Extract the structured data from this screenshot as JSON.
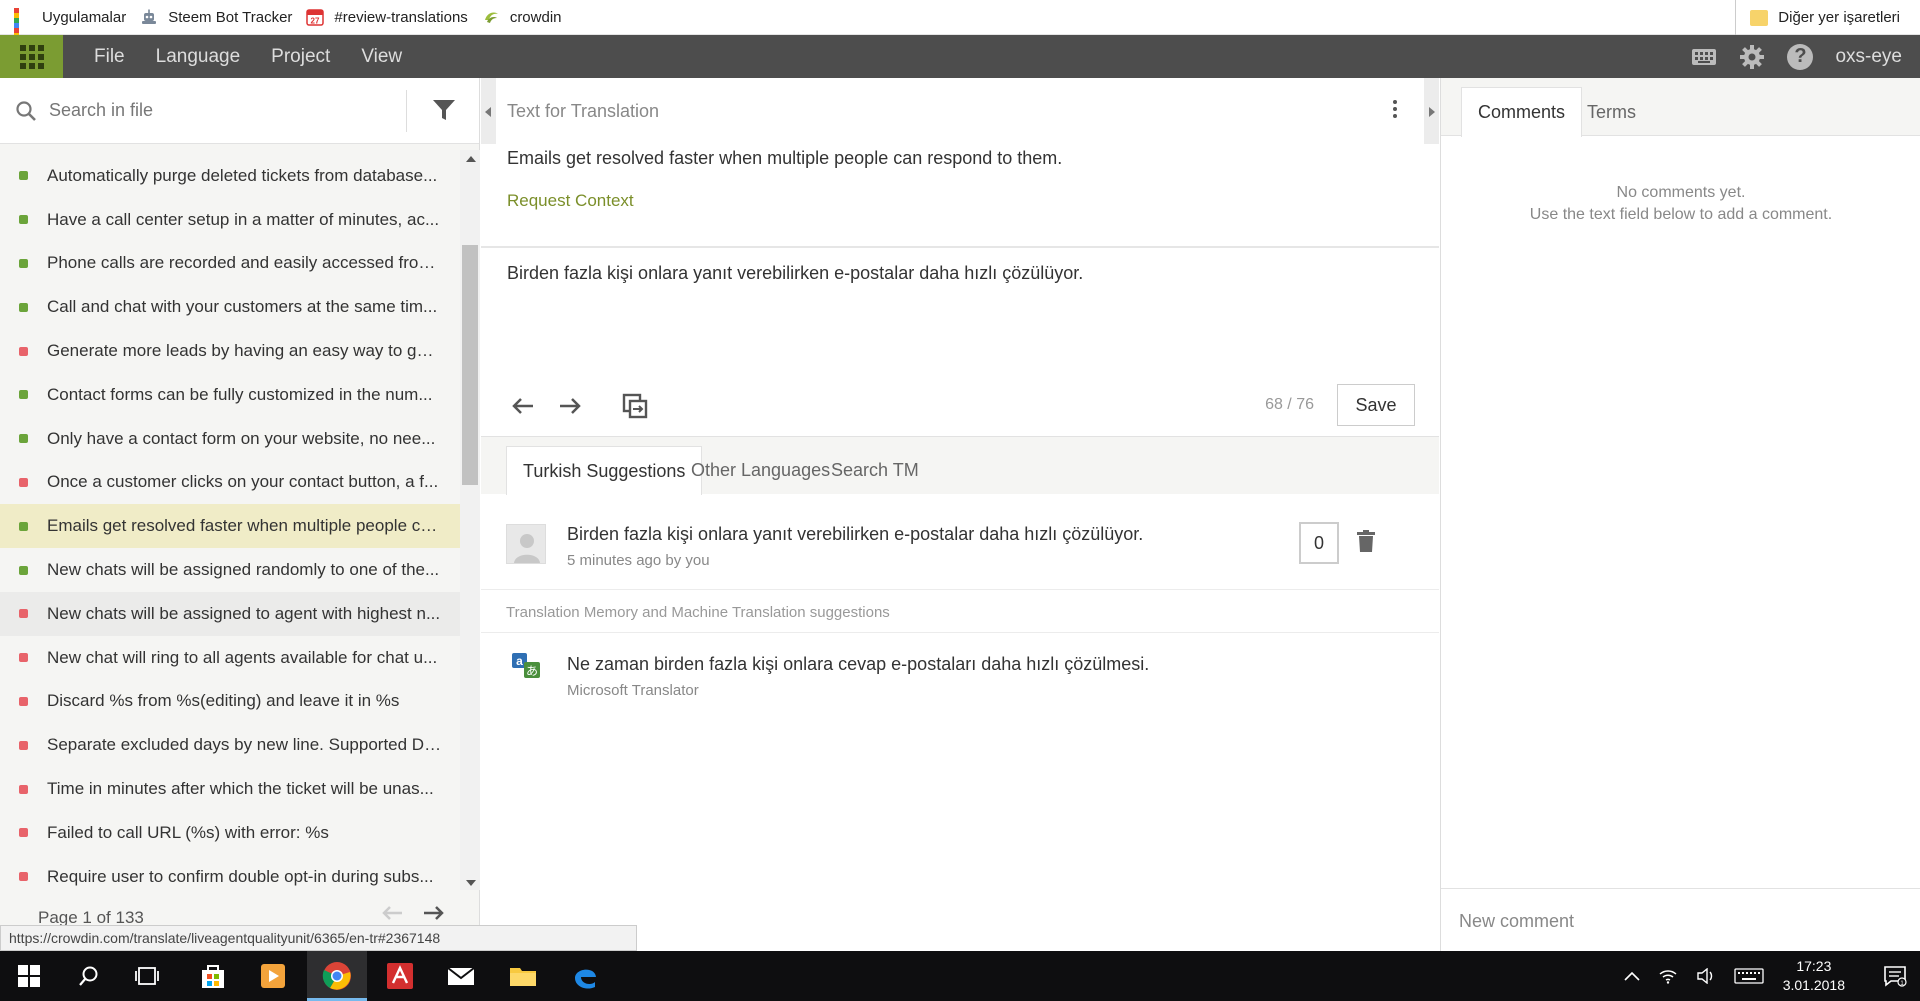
{
  "bookmarks": {
    "items": [
      {
        "label": "Uygulamalar",
        "icon": "apps-grid-icon"
      },
      {
        "label": "Steem Bot Tracker",
        "icon": "robot-icon"
      },
      {
        "label": "#review-translations",
        "icon": "calendar-icon",
        "badge": "27"
      },
      {
        "label": "crowdin",
        "icon": "crowdin-icon"
      }
    ],
    "other": "Diğer yer işaretleri"
  },
  "menubar": {
    "items": [
      "File",
      "Language",
      "Project",
      "View"
    ],
    "user": "oxs-eye",
    "accent": "#7b9c32"
  },
  "left": {
    "search_placeholder": "Search in file",
    "strings": [
      {
        "text": "Automatically purge deleted tickets from database...",
        "status": "translated"
      },
      {
        "text": "Have a call center setup in a matter of minutes, ac...",
        "status": "translated"
      },
      {
        "text": "Phone calls are recorded and easily accessed from...",
        "status": "translated"
      },
      {
        "text": "Call and chat with your customers at the same tim...",
        "status": "translated"
      },
      {
        "text": "Generate more leads by having an easy way to get...",
        "status": "untranslated"
      },
      {
        "text": "Contact forms can be fully customized in the num...",
        "status": "translated"
      },
      {
        "text": "Only have a contact form on your website, no nee...",
        "status": "translated"
      },
      {
        "text": "Once a customer clicks on your contact button, a f...",
        "status": "untranslated"
      },
      {
        "text": "Emails get resolved faster when multiple people ca...",
        "status": "translated"
      },
      {
        "text": "New chats will be assigned randomly to one of the...",
        "status": "translated"
      },
      {
        "text": "New chats will be assigned to agent with highest n...",
        "status": "untranslated"
      },
      {
        "text": "New chat will ring to all agents available for chat u...",
        "status": "untranslated"
      },
      {
        "text": "Discard %s from %s(editing) and leave it in %s",
        "status": "untranslated"
      },
      {
        "text": "Separate excluded days by new line. Supported Da...",
        "status": "untranslated"
      },
      {
        "text": "Time in minutes after which the ticket will be unas...",
        "status": "untranslated"
      },
      {
        "text": "Failed to call URL (%s) with error: %s",
        "status": "untranslated"
      },
      {
        "text": "Require user to confirm double opt-in during subs...",
        "status": "untranslated"
      }
    ],
    "pager": "Page 1 of 133",
    "colors": {
      "translated": "#6ba43a",
      "untranslated": "#e8636a"
    }
  },
  "editor": {
    "title": "Text for Translation",
    "source": "Emails get resolved faster when multiple people can respond to them.",
    "request_context": "Request Context",
    "translation": "Birden fazla kişi onlara yanıt verebilirken e-postalar daha hızlı çözülüyor.",
    "counter": "68 / 76",
    "save_label": "Save",
    "tabs": [
      "Turkish Suggestions",
      "Other Languages",
      "Search TM"
    ],
    "suggestion": {
      "text": "Birden fazla kişi onlara yanıt verebilirken e-postalar daha hızlı çözülüyor.",
      "meta": "5 minutes ago by you",
      "votes": "0"
    },
    "tm_label": "Translation Memory and Machine Translation suggestions",
    "machine": {
      "text": "Ne zaman birden fazla kişi onlara cevap e-postaları daha hızlı çözülmesi.",
      "source": "Microsoft Translator"
    }
  },
  "comments": {
    "tabs": [
      "Comments",
      "Terms"
    ],
    "empty_line1": "No comments yet.",
    "empty_line2": "Use the text field below to add a comment.",
    "placeholder": "New comment"
  },
  "status_url": "https://crowdin.com/translate/liveagentqualityunit/6365/en-tr#2367148",
  "taskbar": {
    "time": "17:23",
    "date": "3.01.2018",
    "notifications": "1"
  }
}
